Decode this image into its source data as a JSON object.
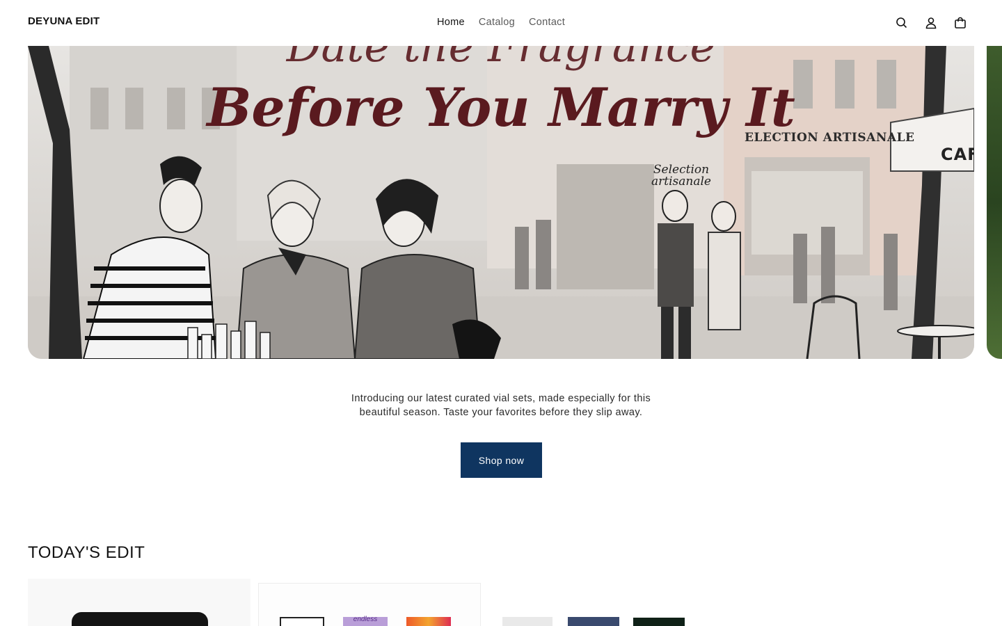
{
  "header": {
    "logo": "DEYUNA EDIT",
    "nav": [
      {
        "label": "Home",
        "active": true
      },
      {
        "label": "Catalog",
        "active": false
      },
      {
        "label": "Contact",
        "active": false
      }
    ],
    "icons": [
      "search-icon",
      "account-icon",
      "cart-icon"
    ]
  },
  "banner": {
    "title_top": "Date the Fragrance",
    "title_main": "Before You Marry It",
    "shop_sign": "ELECTION ARTISANALE",
    "selection_sign_line1": "Selection",
    "selection_sign_line2": "artisanale",
    "cafe_sign": "CAFI"
  },
  "intro": {
    "text": "Introducing our latest curated vial sets, made especially for this beautiful season. Taste your favorites before they slip away.",
    "cta": "Shop now"
  },
  "edit": {
    "title": "TODAY'S EDIT",
    "card2_box_label": "endless"
  },
  "colors": {
    "accent": "#0f3560",
    "banner_title": "#5a1a1f"
  }
}
